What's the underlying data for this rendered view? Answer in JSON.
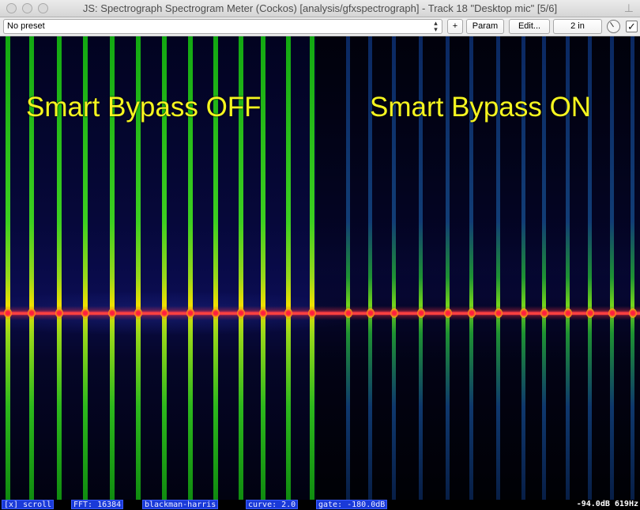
{
  "window": {
    "title": "JS: Spectrograph Spectrogram Meter (Cockos) [analysis/gfxspectrograph] - Track 18 \"Desktop mic\" [5/6]"
  },
  "toolbar": {
    "preset_value": "No preset",
    "plus_label": "+",
    "param_label": "Param",
    "edit_label": "Edit...",
    "io_label": "2 in",
    "enabled_mark": "✓"
  },
  "overlay": {
    "left_label": "Smart Bypass OFF",
    "right_label": "Smart Bypass ON"
  },
  "status": {
    "scroll": "[x] scroll",
    "fft": "FFT: 16384",
    "window_fn": "blackman-harris",
    "curve": "curve: 2.0",
    "gate": "gate: -180.0dB",
    "readout": "-94.0dB 619Hz"
  },
  "colors": {
    "overlay_text": "#f5f520",
    "status_chip": "#1a3ad8"
  },
  "icons": [
    "close-icon",
    "minimize-icon",
    "zoom-icon",
    "pin-icon",
    "updown-arrows-icon",
    "wet-knob-icon",
    "checkbox-icon"
  ]
}
